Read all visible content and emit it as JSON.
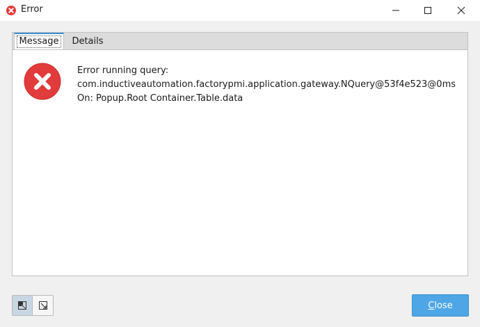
{
  "window": {
    "title": "Error",
    "minimize_icon": "minimize-icon",
    "maximize_icon": "maximize-icon",
    "close_icon": "close-icon"
  },
  "tabs": [
    {
      "label": "Message",
      "selected": true
    },
    {
      "label": "Details",
      "selected": false
    }
  ],
  "message": {
    "icon": "error-icon",
    "lines": [
      "Error running query:",
      "com.inductiveautomation.factorypmi.application.gateway.NQuery@53f4e523@0ms",
      "On: Popup.Root Container.Table.data"
    ]
  },
  "footer": {
    "toggle_buttons": [
      "dock-icon",
      "undock-icon"
    ],
    "close_label_mnemonic": "C",
    "close_label_rest": "lose"
  },
  "colors": {
    "accent": "#4ea6e6",
    "error_red": "#e23b3b",
    "tab_highlight": "#3c8fd4"
  }
}
